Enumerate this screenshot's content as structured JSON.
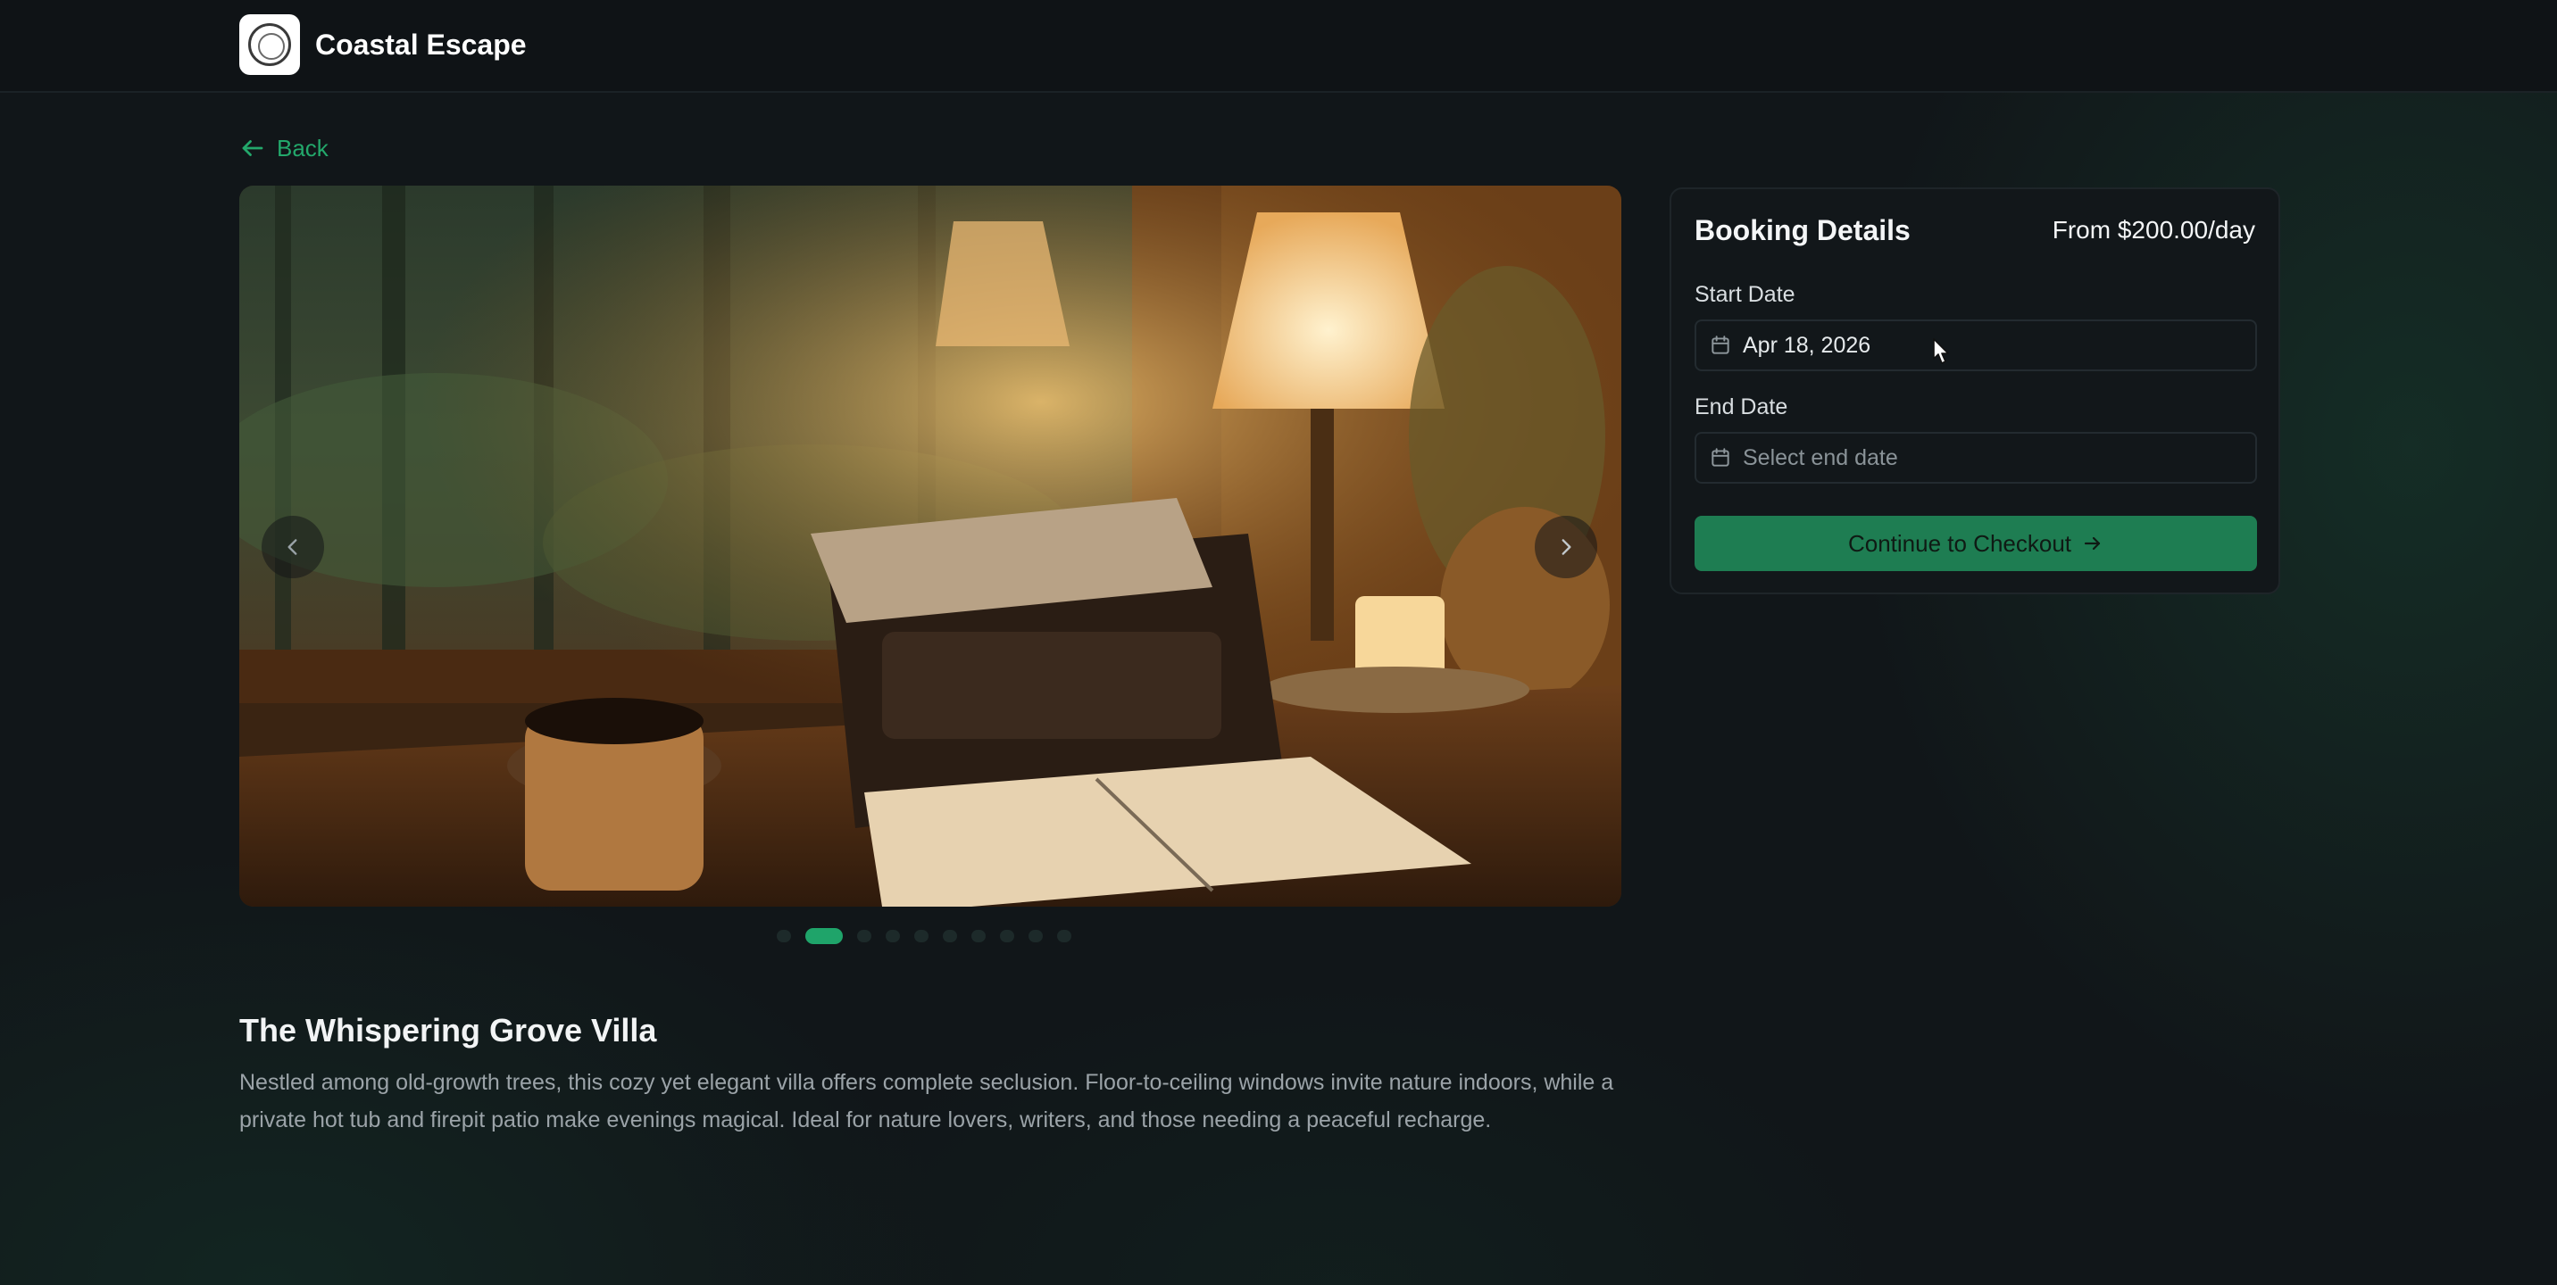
{
  "header": {
    "brand": "Coastal Escape",
    "logo_icon": "seal-logo-icon"
  },
  "nav": {
    "back_label": "Back"
  },
  "gallery": {
    "image_alt": "Typewriter on wooden desk by rainy window with lamp, candle, coffee mug and flowers",
    "prev_icon": "chevron-left-icon",
    "next_icon": "chevron-right-icon",
    "total_slides": 10,
    "active_slide": 2
  },
  "listing": {
    "title": "The Whispering Grove Villa",
    "description": "Nestled among old-growth trees, this cozy yet elegant villa offers complete seclusion. Floor-to-ceiling windows invite nature indoors, while a private hot tub and firepit patio make evenings magical. Ideal for nature lovers, writers, and those needing a peaceful recharge."
  },
  "booking": {
    "title": "Booking Details",
    "price": "From $200.00/day",
    "start_label": "Start Date",
    "start_value": "Apr 18, 2026",
    "end_label": "End Date",
    "end_placeholder": "Select end date",
    "checkout_label": "Continue to Checkout"
  },
  "colors": {
    "accent": "#1fa46a",
    "button": "#1e7d52",
    "background": "#111619",
    "card": "#12171a"
  }
}
